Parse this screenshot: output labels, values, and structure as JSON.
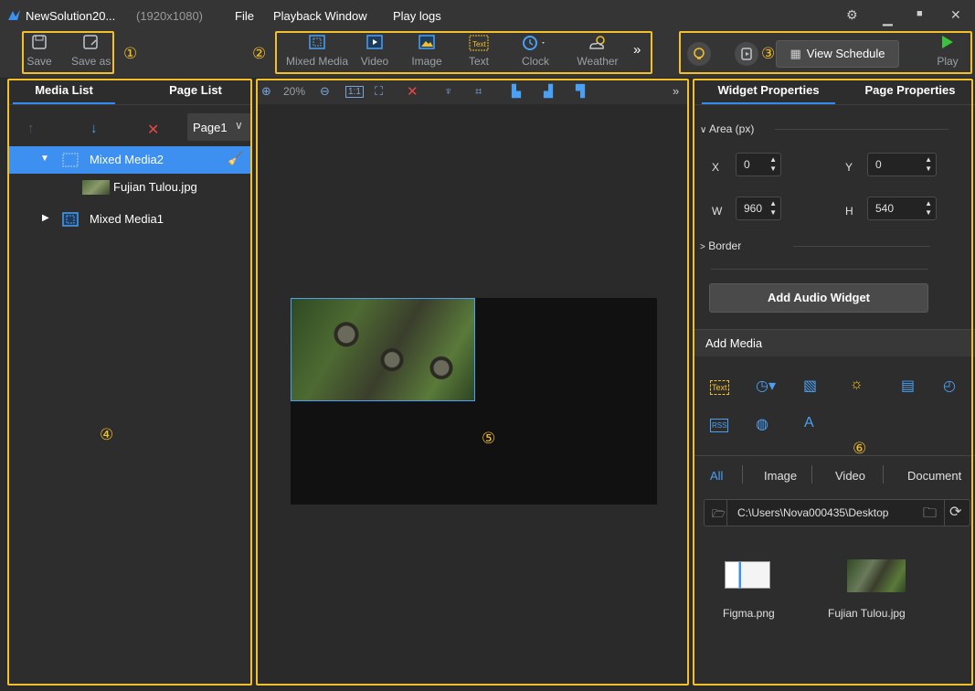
{
  "titlebar": {
    "app_name": "NewSolution20...",
    "resolution": "(1920x1080)",
    "menus": [
      "File",
      "Playback Window",
      "Play logs"
    ]
  },
  "toolbar": {
    "save": "Save",
    "save_as": "Save as",
    "widgets": [
      "Mixed Media",
      "Video",
      "Image",
      "Text",
      "Clock",
      "Weather"
    ],
    "view_schedule": "View Schedule",
    "play": "Play",
    "markers": [
      "①",
      "②",
      "③",
      "④",
      "⑤",
      "⑥"
    ]
  },
  "left": {
    "tabs": [
      "Media List",
      "Page List"
    ],
    "page_select": "Page1",
    "tree": [
      {
        "label": "Mixed Media2"
      },
      {
        "label": "Fujian Tulou.jpg"
      },
      {
        "label": "Mixed Media1"
      }
    ]
  },
  "center": {
    "zoom": "20%"
  },
  "right": {
    "tabs": [
      "Widget Properties",
      "Page Properties"
    ],
    "area_label": "Area (px)",
    "x_label": "X",
    "x_value": "0",
    "y_label": "Y",
    "y_value": "0",
    "w_label": "W",
    "w_value": "960",
    "h_label": "H",
    "h_value": "540",
    "border_label": "Border",
    "add_audio": "Add Audio Widget",
    "add_media": "Add Media",
    "filters": [
      "All",
      "Image",
      "Video",
      "Document"
    ],
    "path": "C:\\Users\\Nova000435\\Desktop",
    "files": [
      "Figma.png",
      "Fujian Tulou.jpg"
    ],
    "icon_labels": [
      "Text",
      "RSS"
    ]
  },
  "colors": {
    "accent": "#3d8ff0",
    "highlight": "#f4c028"
  }
}
